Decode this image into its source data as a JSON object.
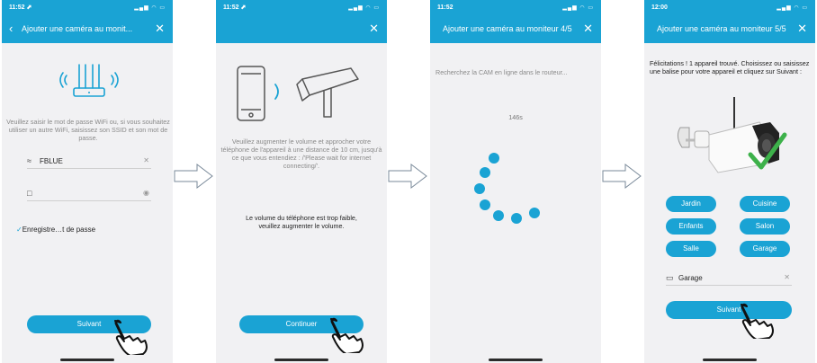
{
  "colors": {
    "accent": "#1aa3d4",
    "screen_bg": "#f1f1f3",
    "check": "#3db14a"
  },
  "screens": [
    {
      "status_time": "11:52 ⬈",
      "title": "Ajouter une caméra au monit...",
      "instruction": "Veuillez saisir le mot de passe WiFi ou, si vous souhaitez utiliser un autre WiFi, saisissez son SSID et son mot de passe.",
      "ssid_value": "FBLUE",
      "password_value": "",
      "remember_label": "Enregistre…t de passe",
      "button_label": "Suivant"
    },
    {
      "status_time": "11:52 ⬈",
      "instruction": "Veuillez augmenter le volume et approcher votre téléphone de l'appareil à une distance de 10 cm, jusqu'à ce que vous entendiez : /'Please wait for internet connecting/'.",
      "warning": "Le volume du téléphone est trop faible, veuillez augmenter le volume.",
      "button_label": "Continuer"
    },
    {
      "status_time": "11:52",
      "title": "Ajouter une caméra au moniteur 4/5",
      "message": "Recherchez la CAM en ligne dans le routeur...",
      "countdown": "146s"
    },
    {
      "status_time": "12:00",
      "title": "Ajouter une caméra au moniteur 5/5",
      "message": "Félicitations ! 1 appareil trouvé. Choisissez ou saisissez une balise pour votre appareil et cliquez sur Suivant :",
      "tags": [
        "Jardin",
        "Cuisine",
        "Enfants",
        "Salon",
        "Salle",
        "Garage"
      ],
      "tag_value": "Garage",
      "button_label": "Suivant"
    }
  ]
}
